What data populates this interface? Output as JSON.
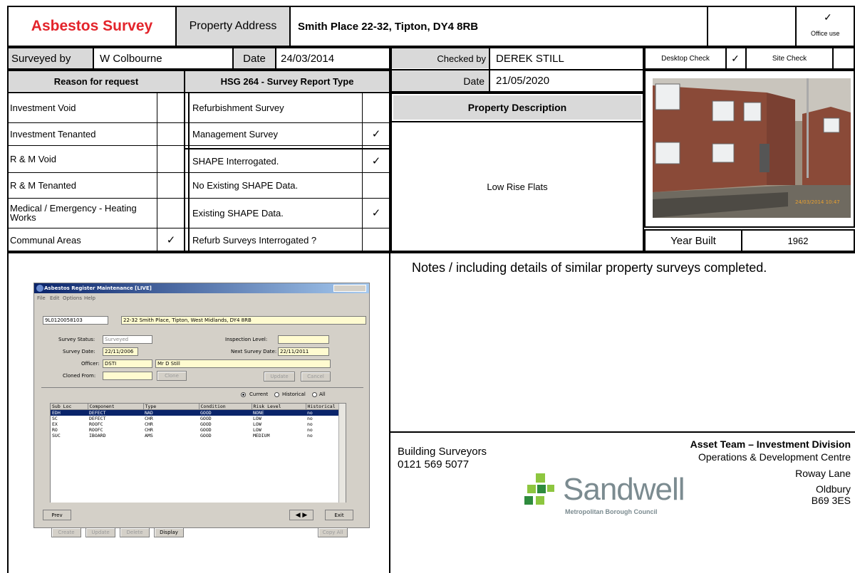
{
  "header": {
    "title": "Asbestos Survey",
    "address_label": "Property Address",
    "address_value": "Smith Place 22-32, Tipton, DY4 8RB",
    "office_use_label": "Office use",
    "office_use_check": "✓"
  },
  "survey": {
    "surveyed_by_label": "Surveyed by",
    "surveyed_by_value": "W Colbourne",
    "date_label": "Date",
    "date_value": "24/03/2014",
    "checked_by_label": "Checked by",
    "checked_by_value": "DEREK STILL",
    "checked_date_label": "Date",
    "checked_date_value": "21/05/2020",
    "desktop_check_label": "Desktop Check",
    "desktop_check_mark": "✓",
    "site_check_label": "Site Check"
  },
  "reasons": {
    "heading": "Reason for request",
    "items": [
      {
        "label": "Investment Void",
        "mark": ""
      },
      {
        "label": "Investment Tenanted",
        "mark": ""
      },
      {
        "label": "R & M Void",
        "mark": ""
      },
      {
        "label": "R & M Tenanted",
        "mark": ""
      },
      {
        "label": "Medical / Emergency - Heating Works",
        "mark": ""
      },
      {
        "label": "Communal Areas",
        "mark": "✓"
      }
    ]
  },
  "report_type": {
    "heading": "HSG 264 - Survey Report Type",
    "items": [
      {
        "label": "Refurbishment Survey",
        "mark": ""
      },
      {
        "label": "Management Survey",
        "mark": "✓"
      },
      {
        "label": "SHAPE Interrogated.",
        "mark": "✓"
      },
      {
        "label": "No Existing SHAPE Data.",
        "mark": ""
      },
      {
        "label": "Existing SHAPE Data.",
        "mark": "✓"
      },
      {
        "label": "Refurb Surveys Interrogated ?",
        "mark": ""
      }
    ]
  },
  "property": {
    "heading": "Property Description",
    "description": "Low Rise Flats",
    "year_built_label": "Year Built",
    "year_built_value": "1962",
    "photo_datestamp": "24/03/2014 10:47"
  },
  "notes": {
    "heading": "Notes / including details of similar property surveys completed."
  },
  "footer": {
    "team_name": "Building Surveyors",
    "phone": "0121 569 5077",
    "division": "Asset Team – Investment Division",
    "address_lines": [
      "Operations & Development Centre",
      "Roway Lane",
      "Oldbury",
      "B69 3ES"
    ],
    "logo_name": "Sandwell",
    "logo_sub": "Metropolitan Borough Council"
  },
  "app_window": {
    "title": "Asbestos Register Maintenance [LIVE]",
    "menu": [
      "File",
      "Edit",
      "Options",
      "Help"
    ],
    "ref": "9L0120058103",
    "address": "22-32 Smith Place, Tipton, West Midlands, DY4 8RB",
    "survey_status_label": "Survey Status:",
    "survey_status_value": "Surveyed",
    "inspection_level_label": "Inspection Level:",
    "survey_date_label": "Survey Date:",
    "survey_date_value": "22/11/2006",
    "next_survey_date_label": "Next Survey Date:",
    "next_survey_date_value": "22/11/2011",
    "officer_label": "Officer:",
    "officer_code": "DSTI",
    "officer_name": "Mr D Still",
    "cloned_from_label": "Cloned From:",
    "clone_button": "Clone",
    "update_button": "Update",
    "cancel_button": "Cancel",
    "radio_current": "Current",
    "radio_historical": "Historical",
    "radio_all": "All",
    "columns": [
      "Sub Loc",
      "Component",
      "Type",
      "Condition",
      "Risk Level",
      "Historical"
    ],
    "rows": [
      [
        "EDH",
        "DEFECT",
        "NAD",
        "GOOD",
        "NONE",
        "no"
      ],
      [
        "SC",
        "DEFECT",
        "CHR",
        "GOOD",
        "LOW",
        "no"
      ],
      [
        "EX",
        "ROOFC",
        "CHR",
        "GOOD",
        "LOW",
        "no"
      ],
      [
        "RO",
        "ROOFC",
        "CHR",
        "GOOD",
        "LOW",
        "no"
      ],
      [
        "SUC",
        "IBOARD",
        "AMS",
        "GOOD",
        "MEDIUM",
        "no"
      ]
    ],
    "create_button": "Create",
    "update2_button": "Update",
    "delete_button": "Delete",
    "display_button": "Display",
    "copy_button": "Copy All",
    "prev_button": "Prev",
    "exit_button": "Exit"
  }
}
